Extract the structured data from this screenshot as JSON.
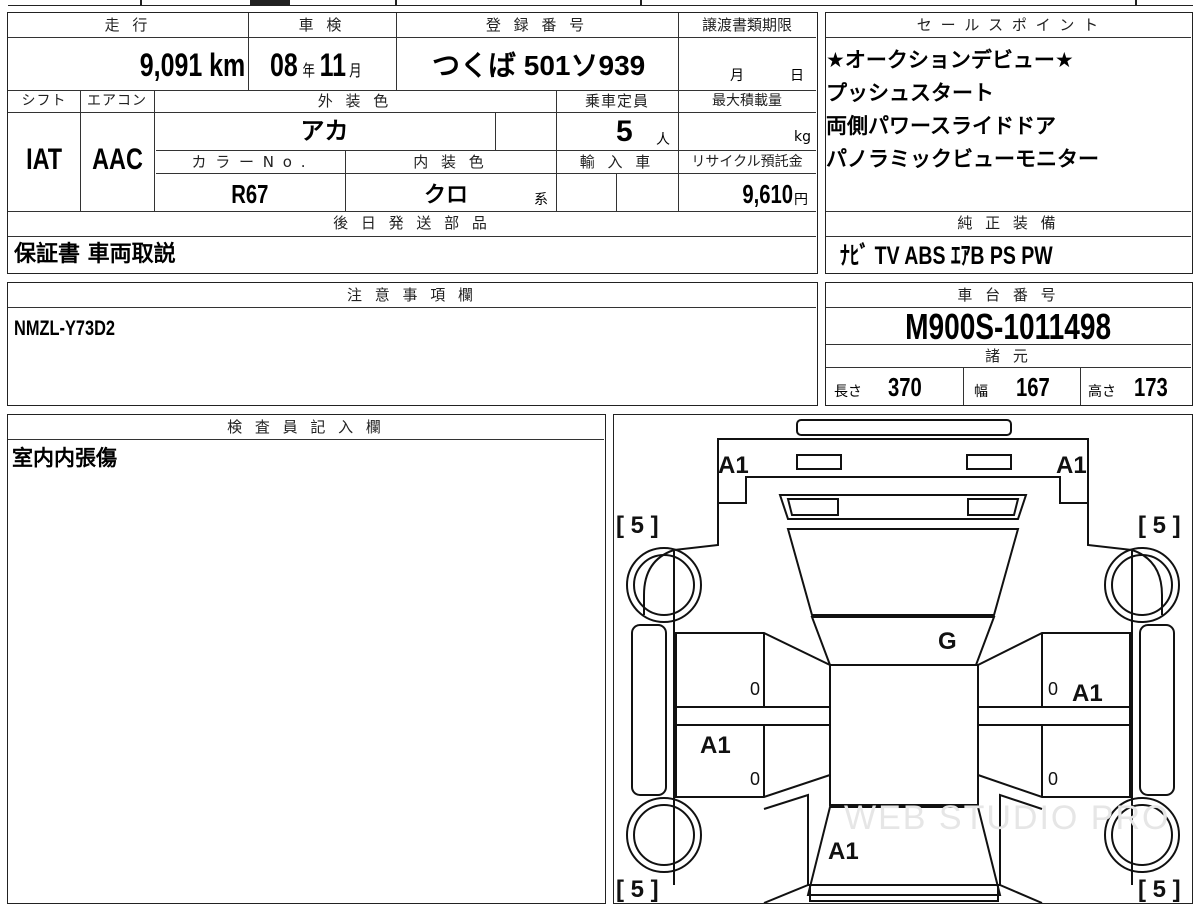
{
  "headers": {
    "mileage": "走 行",
    "inspection": "車 検",
    "registration": "登 録 番 号",
    "transfer_deadline": "譲渡書類期限",
    "shift": "シフト",
    "aircon": "エアコン",
    "exterior_color": "外 装 色",
    "capacity": "乗車定員",
    "max_load": "最大積載量",
    "color_no": "カ ラ ー N o .",
    "interior_color": "内 装 色",
    "import": "輸 入 車",
    "recycle": "リサイクル預託金",
    "later_parts": "後 日 発 送 部 品",
    "sales_points": "セ ー ル ス ポ イ ン ト",
    "equipment": "純 正 装 備",
    "notes": "注 意 事 項 欄",
    "chassis": "車 台 番 号",
    "specs": "諸 元",
    "inspector": "検 査 員 記 入 欄"
  },
  "vehicle": {
    "mileage_value": "9,091",
    "mileage_unit": "km",
    "inspection_year": "08",
    "year_unit": "年",
    "inspection_month": "11",
    "month_unit": "月",
    "registration_number": "つくば 501ソ939",
    "deadline_month_unit": "月",
    "deadline_day_unit": "日",
    "shift_value": "IAT",
    "aircon_value": "AAC",
    "exterior_color_value": "アカ",
    "capacity_value": "5",
    "capacity_unit": "人",
    "max_load_unit": "kg",
    "color_no_value": "R67",
    "interior_color_value": "クロ",
    "interior_suffix": "系",
    "recycle_value": "9,610",
    "recycle_unit": "円",
    "later_parts_value": "保証書 車両取説",
    "notes_value": "NMZL-Y73D2",
    "chassis_value": "M900S-1011498",
    "length_label": "長さ",
    "length_value": "370",
    "width_label": "幅",
    "width_value": "167",
    "height_label": "高さ",
    "height_value": "173",
    "inspector_value": "室内内張傷"
  },
  "sales_points": [
    "★オークションデビュー★",
    "プッシュスタート",
    "両側パワースライドドア",
    "パノラミックビューモニター"
  ],
  "equipment_value": "ﾅﾋﾞ TV ABS ｴｱB PS PW",
  "diagram": {
    "front_left": "A1",
    "front_right": "A1",
    "tire_fl": "[ 5 ]",
    "tire_fr": "[ 5 ]",
    "tire_rl": "[ 5 ]",
    "tire_rr": "[ 5 ]",
    "windshield": "G",
    "right_door": "A1",
    "left_rear_door": "A1",
    "rear": "A1",
    "zero_1": "0",
    "zero_2": "0",
    "zero_3": "0",
    "zero_4": "0",
    "watermark": "WEB STUDIO PRO"
  }
}
